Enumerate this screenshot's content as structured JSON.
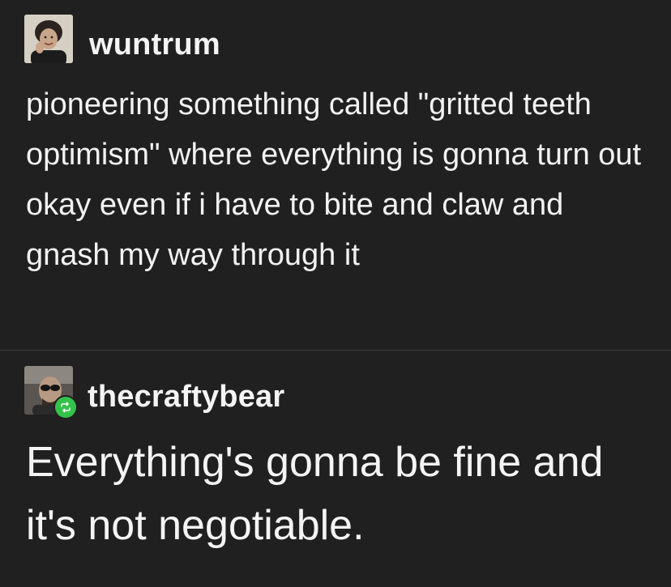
{
  "post_1": {
    "username": "wuntrum",
    "avatar_icon": "user-avatar-portrait",
    "text": "pioneering something called \"gritted teeth optimism\" where everything is gonna turn out okay even if i have to bite and claw and gnash my way through it"
  },
  "post_2": {
    "username": "thecraftybear",
    "avatar_icon": "user-avatar-portrait",
    "badge_icon": "reblog-icon",
    "badge_color": "#35c24a",
    "text": "Everything's gonna be fine and it's not negotiable."
  },
  "colors": {
    "background": "#202020",
    "divider": "#3e3e3e",
    "text": "#f2f2f2"
  }
}
